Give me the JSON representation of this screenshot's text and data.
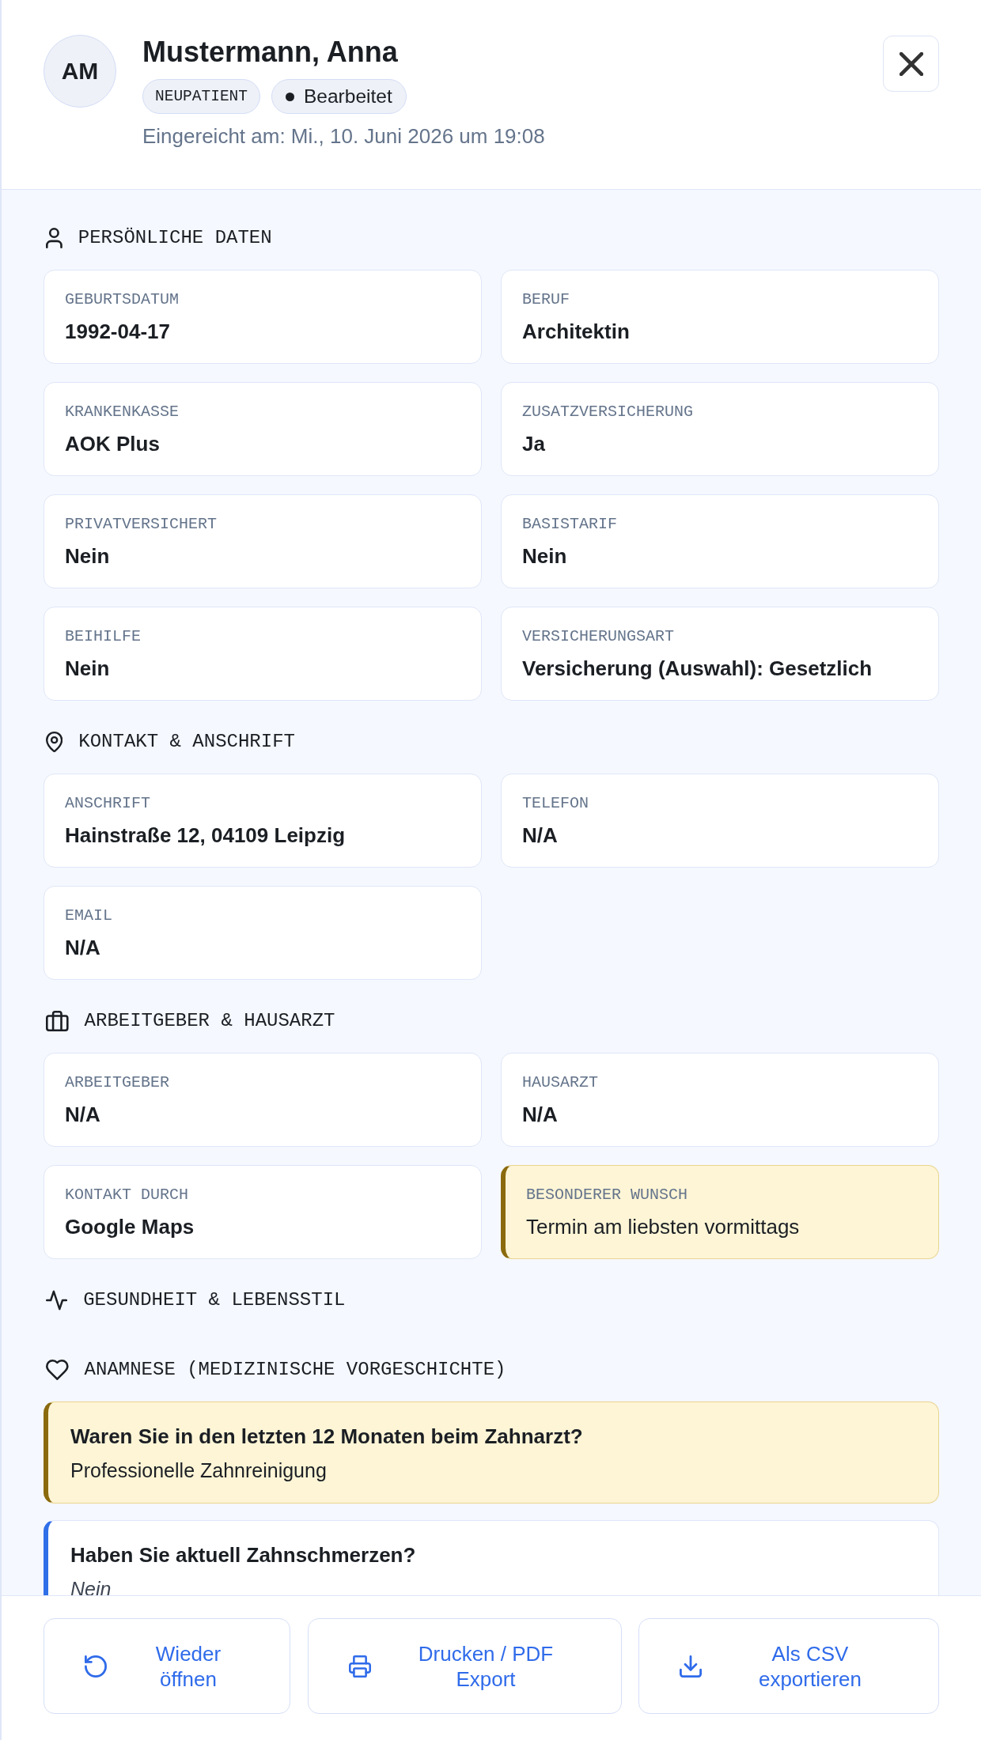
{
  "header": {
    "initials": "AM",
    "name": "Mustermann, Anna",
    "badges": [
      {
        "kind": "tag",
        "label": "NEUPATIENT"
      },
      {
        "kind": "status",
        "label": "Bearbeitet"
      }
    ],
    "submitted": "Eingereicht am: Mi., 10. Juni 2026 um 19:08"
  },
  "sections": [
    {
      "title": "PERSÖNLICHE DATEN",
      "fields": [
        {
          "label": "GEBURTSDATUM",
          "value": "1992-04-17",
          "highlighted": false
        },
        {
          "label": "BERUF",
          "value": "Architektin",
          "highlighted": false
        },
        {
          "label": "KRANKENKASSE",
          "value": "AOK Plus",
          "highlighted": false
        },
        {
          "label": "ZUSATZVERSICHERUNG",
          "value": "Ja",
          "highlighted": false
        },
        {
          "label": "PRIVATVERSICHERT",
          "value": "Nein",
          "highlighted": false
        },
        {
          "label": "BASISTARIF",
          "value": "Nein",
          "highlighted": false
        },
        {
          "label": "BEIHILFE",
          "value": "Nein",
          "highlighted": false
        },
        {
          "label": "VERSICHERUNGSART",
          "value": "Versicherung (Auswahl): Gesetzlich",
          "highlighted": false
        }
      ]
    },
    {
      "title": "KONTAKT & ANSCHRIFT",
      "fields": [
        {
          "label": "ANSCHRIFT",
          "value": "Hainstraße 12, 04109 Leipzig",
          "highlighted": false
        },
        {
          "label": "TELEFON",
          "value": "N/A",
          "highlighted": false
        },
        {
          "label": "EMAIL",
          "value": "N/A",
          "highlighted": false
        }
      ]
    },
    {
      "title": "ARBEITGEBER & HAUSARZT",
      "fields": [
        {
          "label": "ARBEITGEBER",
          "value": "N/A",
          "highlighted": false
        },
        {
          "label": "HAUSARZT",
          "value": "N/A",
          "highlighted": false
        },
        {
          "label": "KONTAKT DURCH",
          "value": "Google Maps",
          "highlighted": false
        },
        {
          "label": "BESONDERER WUNSCH",
          "value": "Termin am liebsten vormittags",
          "highlighted": true
        }
      ]
    },
    {
      "title": "GESUNDHEIT & LEBENSSTIL"
    },
    {
      "title": "ANAMNESE (MEDIZINISCHE VORGESCHICHTE)",
      "questions": [
        {
          "question": "Waren Sie in den letzten 12 Monaten beim Zahnarzt?",
          "answer": "Professionelle Zahnreinigung",
          "highlighted": true
        },
        {
          "question": "Haben Sie aktuell Zahnschmerzen?",
          "answer": "Nein",
          "highlighted": false
        }
      ]
    }
  ],
  "actions": [
    {
      "label": "Wieder öffnen"
    },
    {
      "label": "Drucken / PDF Export"
    },
    {
      "label": "Als CSV exportieren"
    }
  ]
}
